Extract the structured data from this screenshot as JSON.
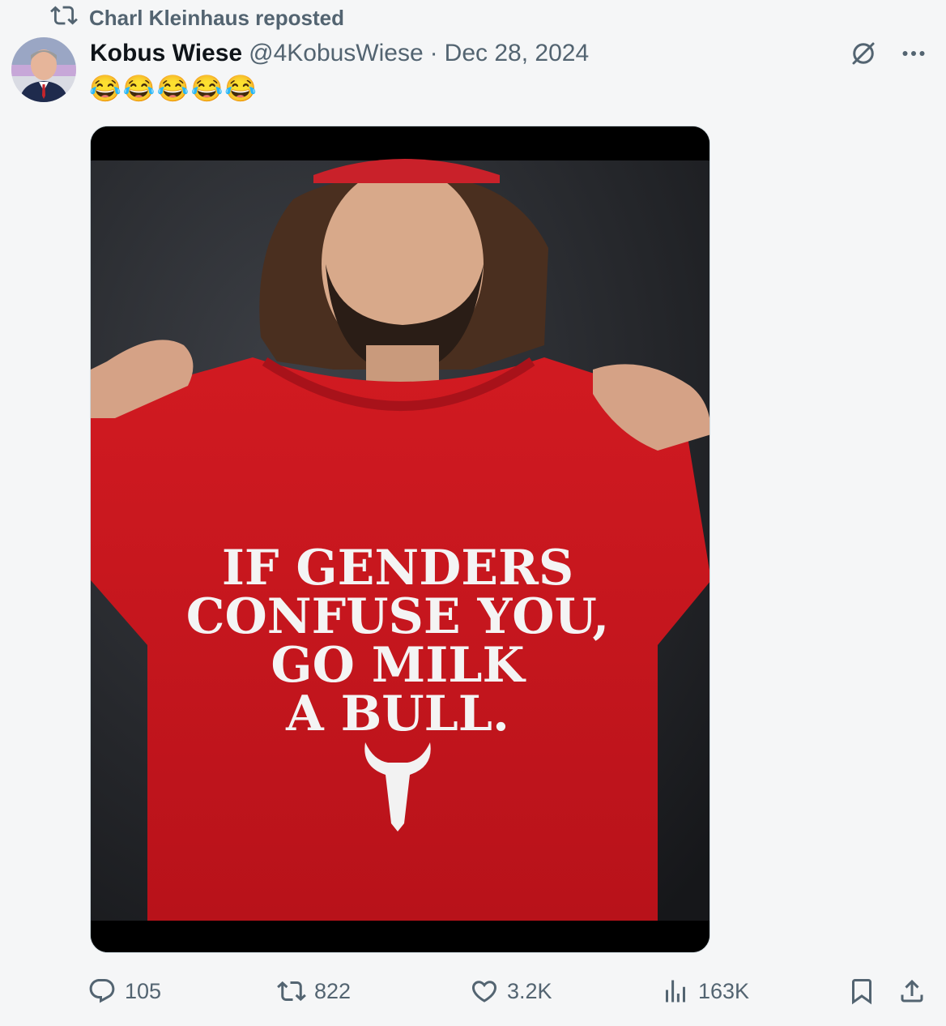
{
  "repost": {
    "label": "Charl Kleinhaus reposted",
    "icon": "repost-icon"
  },
  "tweet": {
    "author_name": "Kobus Wiese",
    "handle": "@4KobusWiese",
    "separator": "·",
    "date": "Dec 28, 2024",
    "text": "😂😂😂😂😂",
    "media": {
      "shirt_text_lines": [
        "IF GENDERS",
        "CONFUSE YOU,",
        "GO MILK",
        "A BULL."
      ],
      "shirt_color": "#c4151c"
    }
  },
  "metrics": {
    "replies": "105",
    "reposts": "822",
    "likes": "3.2K",
    "views": "163K"
  },
  "icons": {
    "grok": "grok-icon",
    "more": "more-icon",
    "reply": "reply-icon",
    "repost": "repost-icon",
    "like": "heart-icon",
    "views": "views-icon",
    "bookmark": "bookmark-icon",
    "share": "share-icon"
  },
  "colors": {
    "muted": "#536471",
    "text": "#0f1419",
    "background": "#f5f6f7"
  }
}
